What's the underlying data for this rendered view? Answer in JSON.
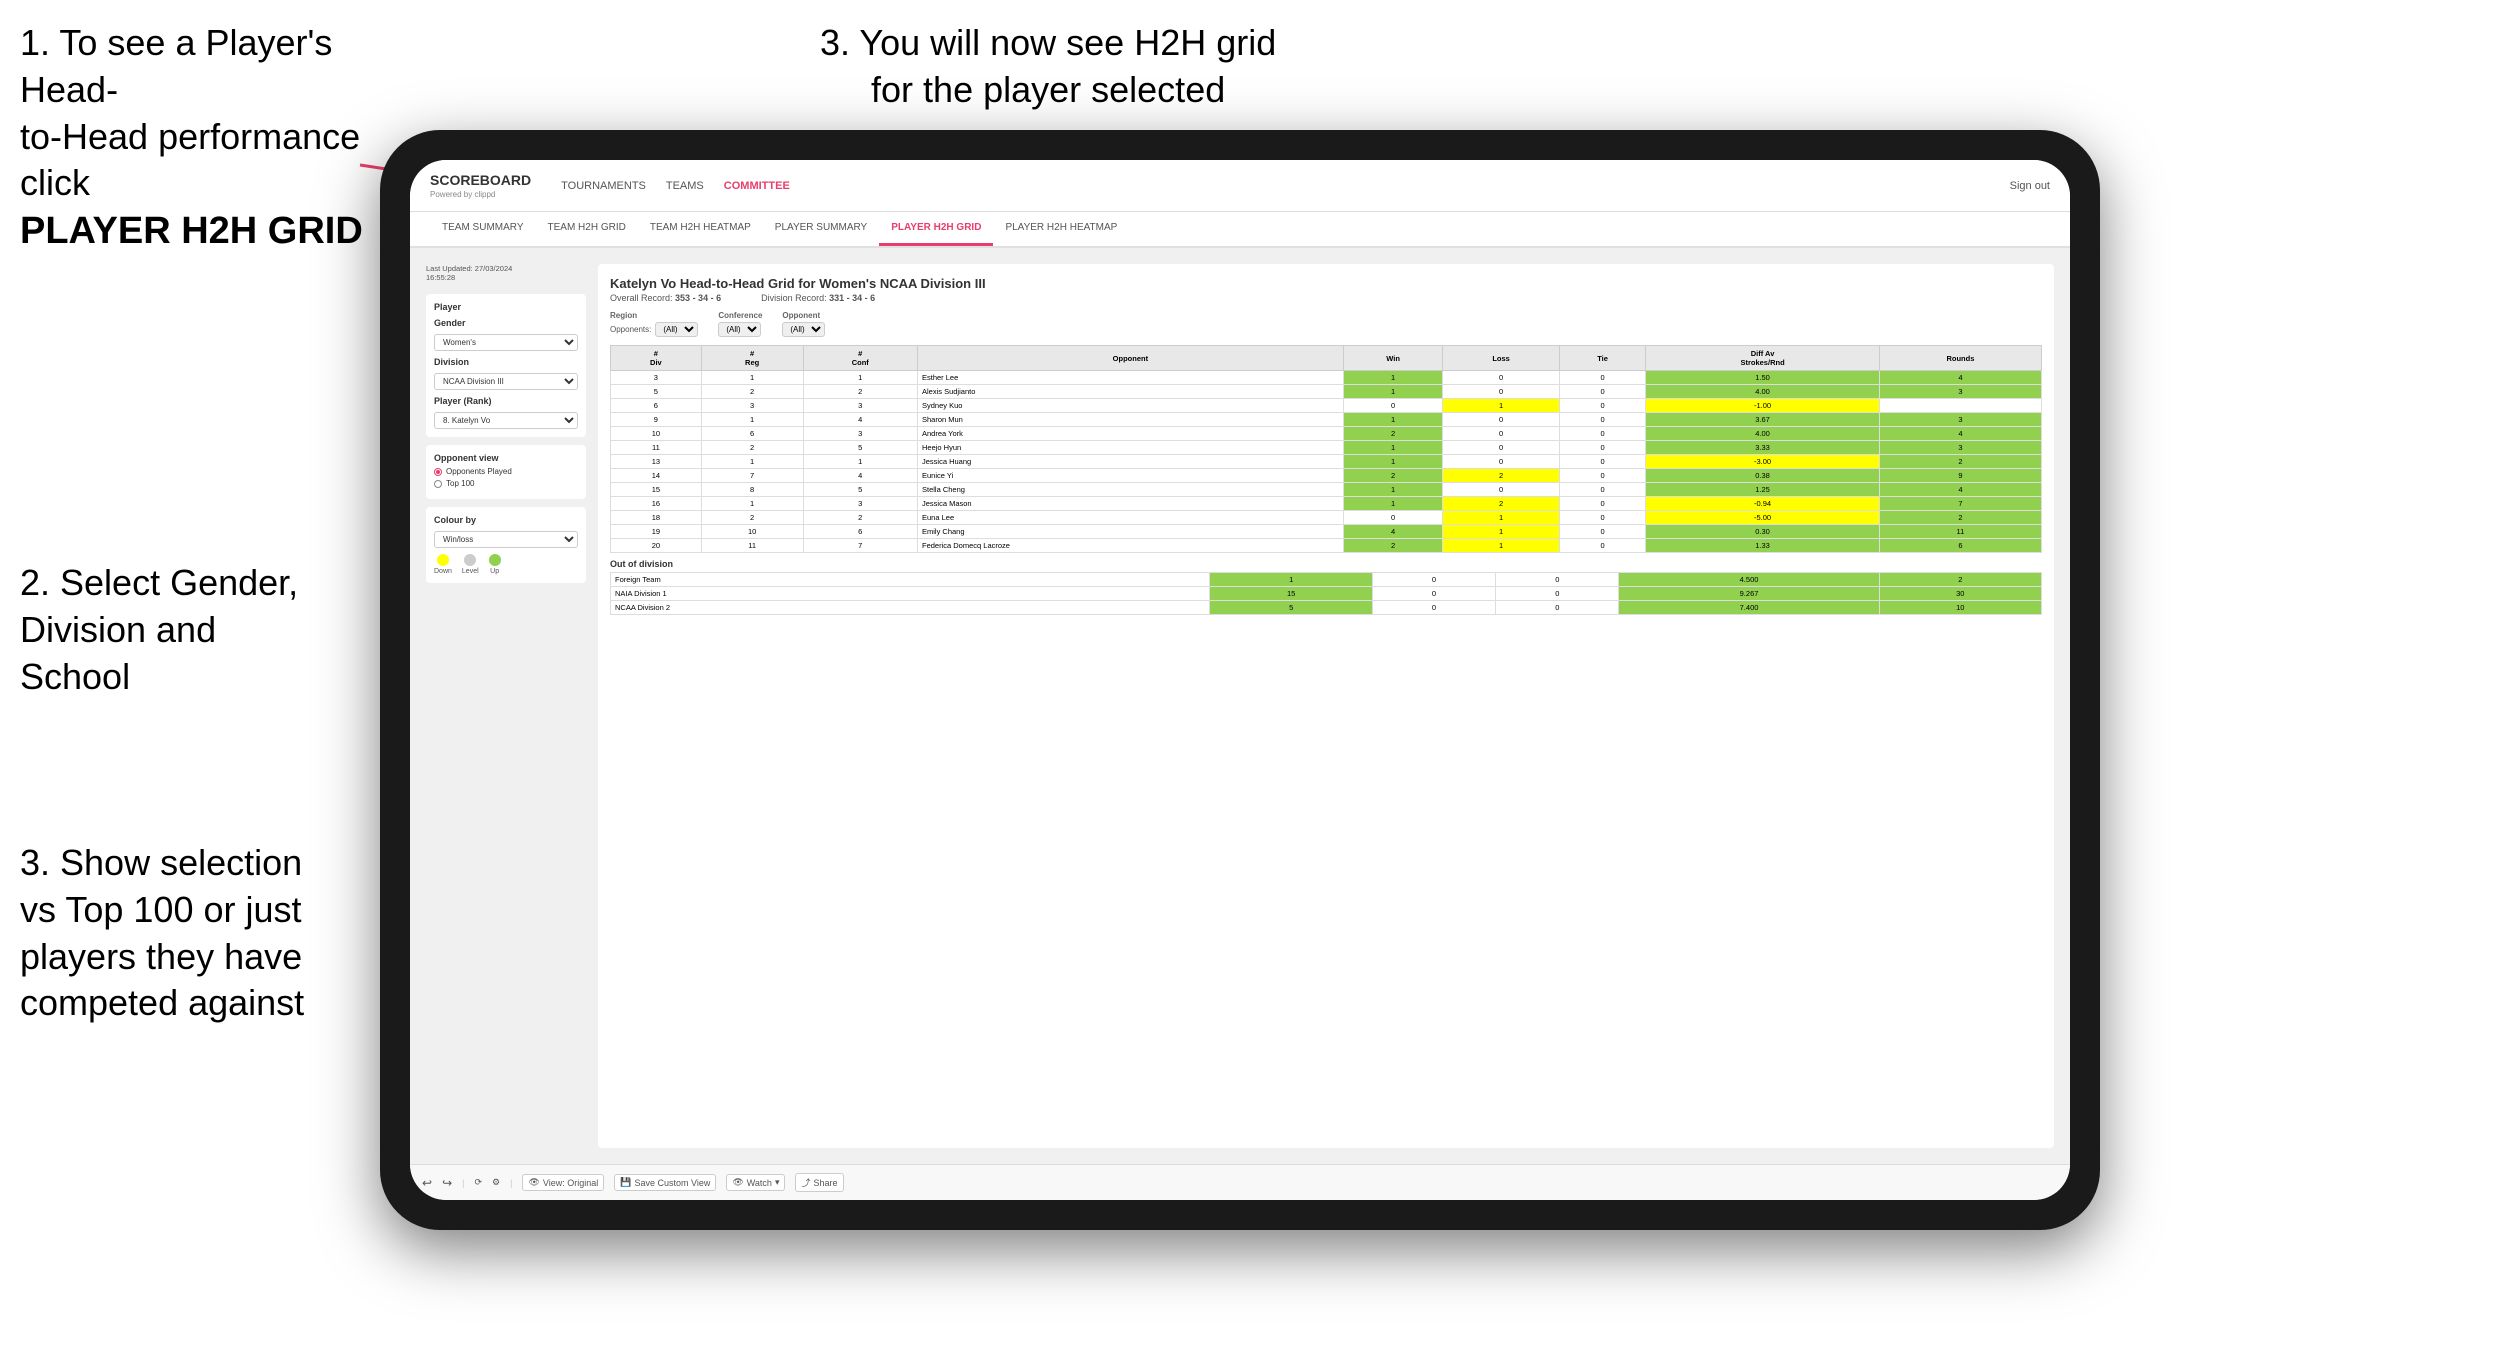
{
  "instructions": {
    "top_left_line1": "1. To see a Player's Head-",
    "top_left_line2": "to-Head performance click",
    "top_left_bold": "PLAYER H2H GRID",
    "top_right": "3. You will now see H2H grid\nfor the player selected",
    "mid_left_line1": "2. Select Gender,",
    "mid_left_line2": "Division and",
    "mid_left_line3": "School",
    "bottom_left_line1": "3. Show selection",
    "bottom_left_line2": "vs Top 100 or just",
    "bottom_left_line3": "players they have",
    "bottom_left_line4": "competed against"
  },
  "nav": {
    "logo": "SCOREBOARD",
    "logo_sub": "Powered by clippd",
    "links": [
      "TOURNAMENTS",
      "TEAMS",
      "COMMITTEE"
    ],
    "sign_out": "Sign out"
  },
  "sub_nav": {
    "items": [
      "TEAM SUMMARY",
      "TEAM H2H GRID",
      "TEAM H2H HEATMAP",
      "PLAYER SUMMARY",
      "PLAYER H2H GRID",
      "PLAYER H2H HEATMAP"
    ],
    "active": "PLAYER H2H GRID"
  },
  "sidebar": {
    "last_updated": "Last Updated: 27/03/2024",
    "last_updated2": "16:55:28",
    "player_label": "Player",
    "gender_label": "Gender",
    "gender_value": "Women's",
    "division_label": "Division",
    "division_value": "NCAA Division III",
    "player_rank_label": "Player (Rank)",
    "player_rank_value": "8. Katelyn Vo",
    "opponent_view_label": "Opponent view",
    "radio1": "Opponents Played",
    "radio2": "Top 100",
    "colour_by_label": "Colour by",
    "colour_by_value": "Win/loss",
    "legend_down": "Down",
    "legend_level": "Level",
    "legend_up": "Up"
  },
  "report": {
    "title": "Katelyn Vo Head-to-Head Grid for Women's NCAA Division III",
    "overall_record_label": "Overall Record:",
    "overall_record": "353 - 34 - 6",
    "division_record_label": "Division Record:",
    "division_record": "331 - 34 - 6",
    "filter_opponents": "Opponents:",
    "filter_all1": "(All)",
    "region_label": "Region",
    "conference_label": "Conference",
    "opponent_label": "Opponent",
    "headers": [
      "# Div",
      "# Reg",
      "# Conf",
      "Opponent",
      "Win",
      "Loss",
      "Tie",
      "Diff Av Strokes/Rnd",
      "Rounds"
    ],
    "rows": [
      {
        "div": 3,
        "reg": 1,
        "conf": 1,
        "opponent": "Esther Lee",
        "win": 1,
        "loss": 0,
        "tie": 0,
        "diff": 1.5,
        "rounds": 4,
        "win_color": "green"
      },
      {
        "div": 5,
        "reg": 2,
        "conf": 2,
        "opponent": "Alexis Sudjianto",
        "win": 1,
        "loss": 0,
        "tie": 0,
        "diff": 4.0,
        "rounds": 3,
        "win_color": "green"
      },
      {
        "div": 6,
        "reg": 3,
        "conf": 3,
        "opponent": "Sydney Kuo",
        "win": 0,
        "loss": 1,
        "tie": 0,
        "diff": -1.0,
        "rounds": "",
        "win_color": "yellow"
      },
      {
        "div": 9,
        "reg": 1,
        "conf": 4,
        "opponent": "Sharon Mun",
        "win": 1,
        "loss": 0,
        "tie": 0,
        "diff": 3.67,
        "rounds": 3,
        "win_color": "green"
      },
      {
        "div": 10,
        "reg": 6,
        "conf": 3,
        "opponent": "Andrea York",
        "win": 2,
        "loss": 0,
        "tie": 0,
        "diff": 4.0,
        "rounds": 4,
        "win_color": "green"
      },
      {
        "div": 11,
        "reg": 2,
        "conf": 5,
        "opponent": "Heejo Hyun",
        "win": 1,
        "loss": 0,
        "tie": 0,
        "diff": 3.33,
        "rounds": 3,
        "win_color": "green"
      },
      {
        "div": 13,
        "reg": 1,
        "conf": 1,
        "opponent": "Jessica Huang",
        "win": 1,
        "loss": 0,
        "tie": 0,
        "diff": -3.0,
        "rounds": 2,
        "win_color": "green"
      },
      {
        "div": 14,
        "reg": 7,
        "conf": 4,
        "opponent": "Eunice Yi",
        "win": 2,
        "loss": 2,
        "tie": 0,
        "diff": 0.38,
        "rounds": 9,
        "win_color": "yellow"
      },
      {
        "div": 15,
        "reg": 8,
        "conf": 5,
        "opponent": "Stella Cheng",
        "win": 1,
        "loss": 0,
        "tie": 0,
        "diff": 1.25,
        "rounds": 4,
        "win_color": "green"
      },
      {
        "div": 16,
        "reg": 1,
        "conf": 3,
        "opponent": "Jessica Mason",
        "win": 1,
        "loss": 2,
        "tie": 0,
        "diff": -0.94,
        "rounds": 7,
        "win_color": "yellow"
      },
      {
        "div": 18,
        "reg": 2,
        "conf": 2,
        "opponent": "Euna Lee",
        "win": 0,
        "loss": 1,
        "tie": 0,
        "diff": -5.0,
        "rounds": 2,
        "win_color": "yellow"
      },
      {
        "div": 19,
        "reg": 10,
        "conf": 6,
        "opponent": "Emily Chang",
        "win": 4,
        "loss": 1,
        "tie": 0,
        "diff": 0.3,
        "rounds": 11,
        "win_color": "green"
      },
      {
        "div": 20,
        "reg": 11,
        "conf": 7,
        "opponent": "Federica Domecq Lacroze",
        "win": 2,
        "loss": 1,
        "tie": 0,
        "diff": 1.33,
        "rounds": 6,
        "win_color": "green"
      }
    ],
    "out_of_division_label": "Out of division",
    "out_rows": [
      {
        "name": "Foreign Team",
        "win": 1,
        "loss": 0,
        "tie": 0,
        "diff": 4.5,
        "rounds": 2,
        "win_color": "green"
      },
      {
        "name": "NAIA Division 1",
        "win": 15,
        "loss": 0,
        "tie": 0,
        "diff": 9.267,
        "rounds": 30,
        "win_color": "green"
      },
      {
        "name": "NCAA Division 2",
        "win": 5,
        "loss": 0,
        "tie": 0,
        "diff": 7.4,
        "rounds": 10,
        "win_color": "green"
      }
    ]
  },
  "toolbar": {
    "undo": "↩",
    "redo": "↪",
    "view_original": "View: Original",
    "save_custom": "Save Custom View",
    "watch": "Watch",
    "share": "Share"
  },
  "colors": {
    "accent": "#e83e6c",
    "green": "#92d050",
    "yellow": "#ffff00",
    "light_green": "#c6efce",
    "legend_down": "#ffff00",
    "legend_level": "#cccccc",
    "legend_up": "#92d050"
  }
}
